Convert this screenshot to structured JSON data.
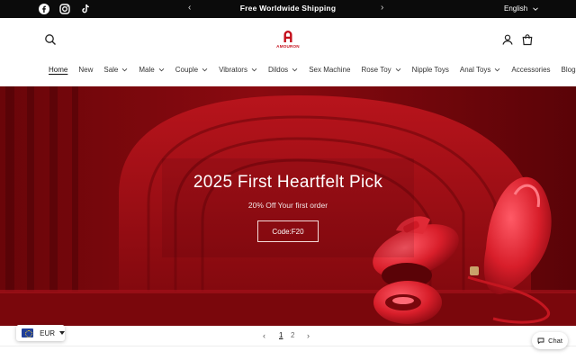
{
  "announcement": {
    "message": "Free Worldwide Shipping",
    "language": "English"
  },
  "icons": {
    "social": [
      "facebook-icon",
      "instagram-icon",
      "tiktok-icon"
    ],
    "header": [
      "search-icon",
      "account-icon",
      "cart-icon"
    ]
  },
  "logo": {
    "wordmark": "AMOURON"
  },
  "nav": {
    "items": [
      {
        "label": "Home",
        "active": true,
        "dropdown": false
      },
      {
        "label": "New",
        "active": false,
        "dropdown": false
      },
      {
        "label": "Sale",
        "active": false,
        "dropdown": true
      },
      {
        "label": "Male",
        "active": false,
        "dropdown": true
      },
      {
        "label": "Couple",
        "active": false,
        "dropdown": true
      },
      {
        "label": "Vibrators",
        "active": false,
        "dropdown": true
      },
      {
        "label": "Dildos",
        "active": false,
        "dropdown": true
      },
      {
        "label": "Sex Machine",
        "active": false,
        "dropdown": false
      },
      {
        "label": "Rose Toy",
        "active": false,
        "dropdown": true
      },
      {
        "label": "Nipple Toys",
        "active": false,
        "dropdown": false
      },
      {
        "label": "Anal Toys",
        "active": false,
        "dropdown": true
      },
      {
        "label": "Accessories",
        "active": false,
        "dropdown": false
      },
      {
        "label": "Blogs",
        "active": false,
        "dropdown": false
      }
    ]
  },
  "hero": {
    "title": "2025 First Heartfelt Pick",
    "subtitle": "20% Off Your first order",
    "code_button": "Code:F20"
  },
  "slider": {
    "pages": [
      "1",
      "2"
    ],
    "current_page": "1"
  },
  "currency": {
    "code": "EUR"
  },
  "chat": {
    "label": "Chat"
  },
  "colors": {
    "announcement_bg": "#0b0b0b",
    "brand_red": "#c40e1a",
    "hero_red": "#8e0c12"
  }
}
